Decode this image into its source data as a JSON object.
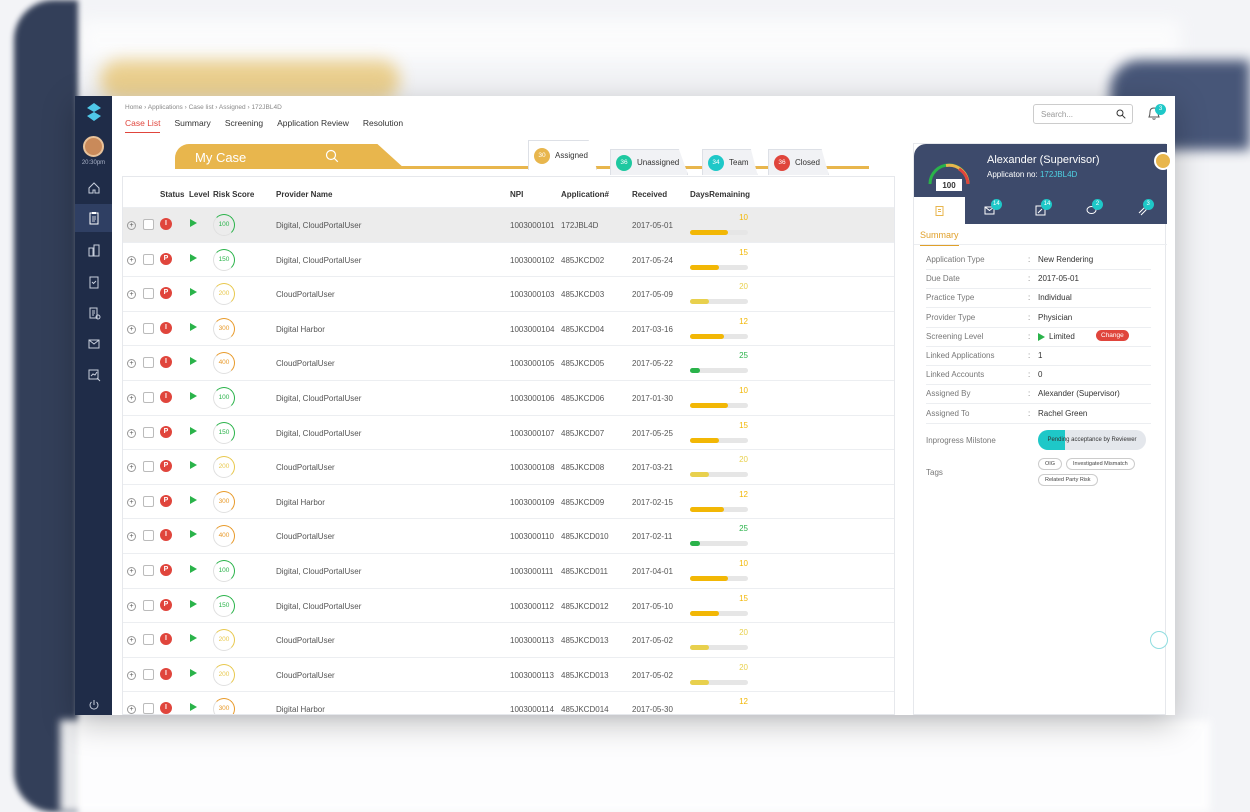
{
  "sidebar": {
    "time": "20:30pm",
    "icons": [
      "home-icon",
      "clipboard-icon",
      "buildings-icon",
      "checklist-icon",
      "document-list-icon",
      "mail-icon",
      "chart-search-icon"
    ]
  },
  "header": {
    "breadcrumb": "Home  ›  Applications  ›  Case list  ›  Assigned  ›  172JBL4D",
    "tabs": [
      "Case List",
      "Summary",
      "Screening",
      "Application Review",
      "Resolution"
    ],
    "search_placeholder": "Search...",
    "notification_count": "3"
  },
  "mycase": {
    "title": "My Case",
    "filters": [
      {
        "count": "30",
        "label": "Assigned",
        "color": "#e8b64d"
      },
      {
        "count": "36",
        "label": "Unassigned",
        "color": "#1ec8a0"
      },
      {
        "count": "34",
        "label": "Team",
        "color": "#1ec8c8"
      },
      {
        "count": "36",
        "label": "Closed",
        "color": "#e0453c"
      }
    ]
  },
  "table": {
    "columns": [
      "Status",
      "Level",
      "Risk Score",
      "Provider Name",
      "NPI",
      "Application#",
      "Received",
      "DaysRemaining"
    ],
    "rows": [
      {
        "status": "I",
        "risk": "100",
        "provider": "Digital, CloudPortalUser",
        "npi": "1003000101",
        "app": "172JBL4D",
        "received": "2017-05-01",
        "days": "10",
        "pct": 0.65
      },
      {
        "status": "P",
        "risk": "150",
        "provider": "Digital, CloudPortalUser",
        "npi": "1003000102",
        "app": "485JKCD02",
        "received": "2017-05-24",
        "days": "15",
        "pct": 0.5
      },
      {
        "status": "P",
        "risk": "200",
        "provider": "CloudPortalUser",
        "npi": "1003000103",
        "app": "485JKCD03",
        "received": "2017-05-09",
        "days": "20",
        "pct": 0.32
      },
      {
        "status": "I",
        "risk": "300",
        "provider": "Digital Harbor",
        "npi": "1003000104",
        "app": "485JKCD04",
        "received": "2017-03-16",
        "days": "12",
        "pct": 0.58
      },
      {
        "status": "I",
        "risk": "400",
        "provider": "CloudPortalUser",
        "npi": "1003000105",
        "app": "485JKCD05",
        "received": "2017-05-22",
        "days": "25",
        "pct": 0.18
      },
      {
        "status": "I",
        "risk": "100",
        "provider": "Digital, CloudPortalUser",
        "npi": "1003000106",
        "app": "485JKCD06",
        "received": "2017-01-30",
        "days": "10",
        "pct": 0.65
      },
      {
        "status": "P",
        "risk": "150",
        "provider": "Digital, CloudPortalUser",
        "npi": "1003000107",
        "app": "485JKCD07",
        "received": "2017-05-25",
        "days": "15",
        "pct": 0.5
      },
      {
        "status": "P",
        "risk": "200",
        "provider": "CloudPortalUser",
        "npi": "1003000108",
        "app": "485JKCD08",
        "received": "2017-03-21",
        "days": "20",
        "pct": 0.32
      },
      {
        "status": "P",
        "risk": "300",
        "provider": "Digital Harbor",
        "npi": "1003000109",
        "app": "485JKCD09",
        "received": "2017-02-15",
        "days": "12",
        "pct": 0.58
      },
      {
        "status": "I",
        "risk": "400",
        "provider": "CloudPortalUser",
        "npi": "1003000110",
        "app": "485JKCD010",
        "received": "2017-02-11",
        "days": "25",
        "pct": 0.18
      },
      {
        "status": "P",
        "risk": "100",
        "provider": "Digital, CloudPortalUser",
        "npi": "1003000111",
        "app": "485JKCD011",
        "received": "2017-04-01",
        "days": "10",
        "pct": 0.65
      },
      {
        "status": "P",
        "risk": "150",
        "provider": "Digital, CloudPortalUser",
        "npi": "1003000112",
        "app": "485JKCD012",
        "received": "2017-05-10",
        "days": "15",
        "pct": 0.5
      },
      {
        "status": "I",
        "risk": "200",
        "provider": "CloudPortalUser",
        "npi": "1003000113",
        "app": "485JKCD013",
        "received": "2017-05-02",
        "days": "20",
        "pct": 0.32
      },
      {
        "status": "I",
        "risk": "200",
        "provider": "CloudPortalUser",
        "npi": "1003000113",
        "app": "485JKCD013",
        "received": "2017-05-02",
        "days": "20",
        "pct": 0.32
      },
      {
        "status": "I",
        "risk": "300",
        "provider": "Digital Harbor",
        "npi": "1003000114",
        "app": "485JKCD014",
        "received": "2017-05-30",
        "days": "12",
        "pct": 0.58
      }
    ]
  },
  "panel": {
    "name": "Alexander (Supervisor)",
    "appno_label": "Applicaton no: ",
    "appno": "172JBL4D",
    "score": "100",
    "tab_badges": [
      "14",
      "14",
      "2",
      "3"
    ],
    "summary_label": "Summary",
    "fields": [
      {
        "k": "Application Type",
        "v": "New Rendering"
      },
      {
        "k": "Due Date",
        "v": "2017-05-01"
      },
      {
        "k": "Practice Type",
        "v": "Individual"
      },
      {
        "k": "Provider Type",
        "v": "Physician"
      },
      {
        "k": "Screening Level",
        "v": "Limited"
      },
      {
        "k": "Linked Applications",
        "v": "1"
      },
      {
        "k": "Linked Accounts",
        "v": "0"
      },
      {
        "k": "Assigned By",
        "v": "Alexander (Supervisor)"
      },
      {
        "k": "Assigned To",
        "v": "Rachel Green"
      }
    ],
    "change_label": "Change",
    "milestone_label": "Inprogress Milstone",
    "milestone_text": "Pending acceptance by Reviewer",
    "milestone_progress": 0.25,
    "tags_label": "Tags",
    "tags": [
      "OIG",
      "Investigated Mismatch",
      "Related Party Risk"
    ]
  },
  "colors": {
    "sidebar": "#1f2c48",
    "accent": "#e8b64d",
    "danger": "#e0453c",
    "teal": "#1ec8c8"
  }
}
